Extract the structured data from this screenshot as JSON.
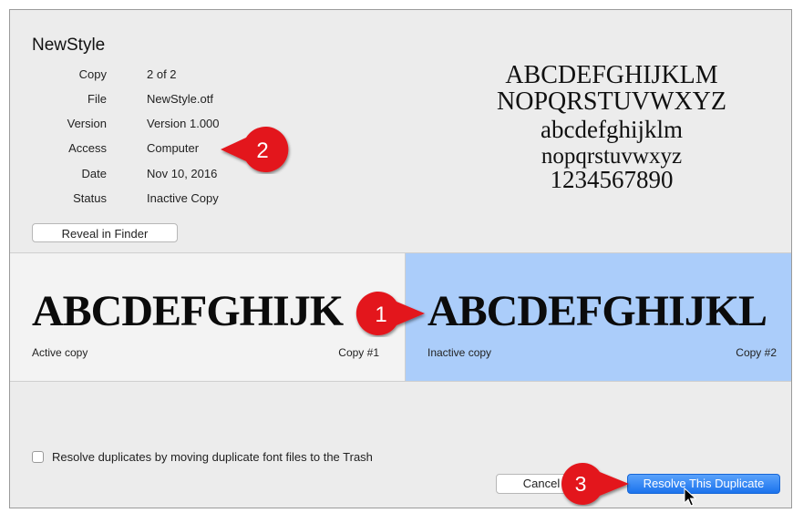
{
  "font": {
    "name": "NewStyle",
    "meta": [
      {
        "label": "Copy",
        "value": "2 of 2"
      },
      {
        "label": "File",
        "value": "NewStyle.otf"
      },
      {
        "label": "Version",
        "value": "Version 1.000"
      },
      {
        "label": "Access",
        "value": "Computer"
      },
      {
        "label": "Date",
        "value": "Nov 10, 2016"
      },
      {
        "label": "Status",
        "value": "Inactive Copy"
      }
    ],
    "reveal_label": "Reveal in Finder",
    "preview_lines": [
      "ABCDEFGHIJKLM",
      "NOPQRSTUVWXYZ",
      "abcdefghijklm",
      "nopqrstuvwxyz",
      "1234567890"
    ]
  },
  "compare": {
    "left": {
      "sample": "ABCDEFGHIJK",
      "caption": "Active copy",
      "copy_label": "Copy #1"
    },
    "right": {
      "sample": "ABCDEFGHIJKL",
      "caption": "Inactive copy",
      "copy_label": "Copy #2"
    }
  },
  "options": {
    "move_to_trash_label": "Resolve duplicates by moving duplicate font files to the Trash",
    "move_to_trash_checked": false
  },
  "buttons": {
    "cancel_label": "Cancel",
    "resolve_label": "Resolve This Duplicate"
  },
  "callouts": {
    "one": "1",
    "two": "2",
    "three": "3"
  },
  "colors": {
    "inactive_pane": "#abcdfa",
    "callout": "#e3141b",
    "primary_button": "#1b73ed"
  }
}
